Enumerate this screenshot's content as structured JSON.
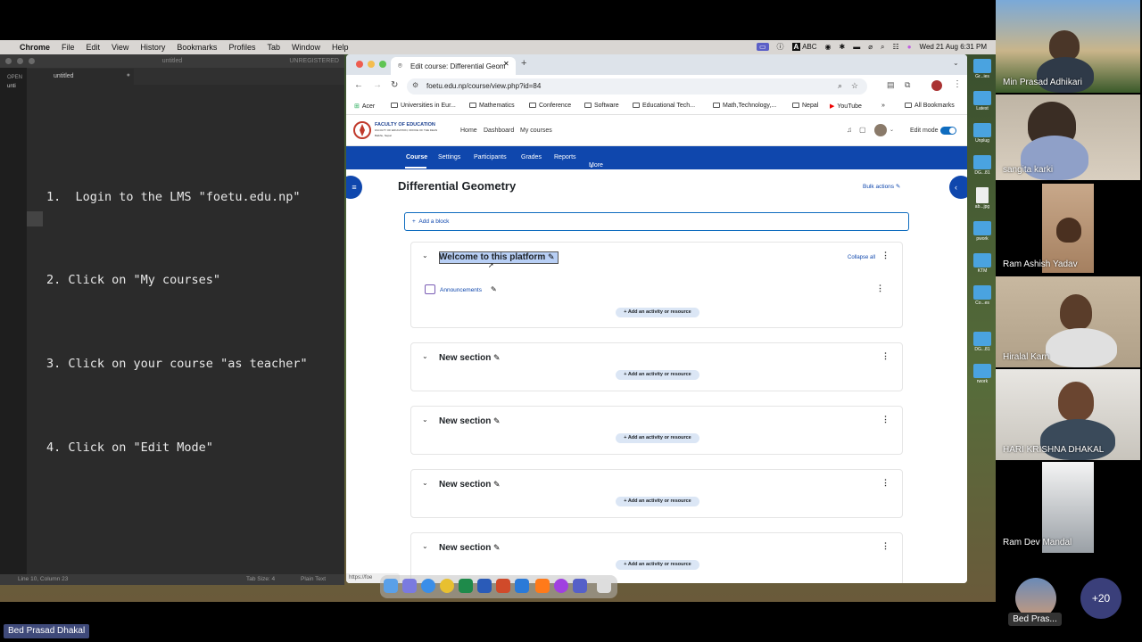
{
  "menubar": {
    "app": "Chrome",
    "items": [
      "File",
      "Edit",
      "View",
      "History",
      "Bookmarks",
      "Profiles",
      "Tab",
      "Window",
      "Help"
    ],
    "clock": "Wed 21 Aug  6:31 PM",
    "abc": "ABC"
  },
  "sublime": {
    "tab_title": "untitled",
    "window_title": "untitled",
    "unregistered": "UNREGISTERED",
    "sidebar_label": "OPEN",
    "sidebar_file": "unti",
    "lines": [
      "1.  Login to the LMS \"foetu.edu.np\"",
      "2. Click on \"My courses\"",
      "3. Click on your course \"as teacher\"",
      "4. Click on \"Edit Mode\""
    ],
    "status_left": "Line 10, Column 23",
    "status_tab": "Tab Size: 4",
    "status_syntax": "Plain Text"
  },
  "chrome": {
    "tab_title": "Edit course: Differential Geom",
    "url": "foetu.edu.np/course/view.php?id=84",
    "bookmarks": [
      "Acer",
      "Universities in Eur...",
      "Mathematics",
      "Conference",
      "Software",
      "Educational Tech...",
      "Math,Technology,...",
      "Nepal",
      "YouTube"
    ],
    "all_bookmarks": "All Bookmarks",
    "status_url": "https://foe"
  },
  "moodle": {
    "logo_title": "FACULTY OF EDUCATION",
    "logo_sub": "FACULTY OF EDUCATION, OFFICE OF THE DEAN",
    "logo_sub2": "Balkhu, Nepal",
    "top_links": [
      "Home",
      "Dashboard",
      "My courses"
    ],
    "edit_mode": "Edit mode",
    "nav": [
      "Course",
      "Settings",
      "Participants",
      "Grades",
      "Reports",
      "More"
    ],
    "course_title": "Differential Geometry",
    "bulk_actions": "Bulk actions",
    "add_block": "Add a block",
    "collapse_all": "Collapse all",
    "first_section": "Welcome to this platform",
    "announcements": "Announcements",
    "add_activity": "Add an activity or resource",
    "new_section": "New section"
  },
  "desktop_icons": [
    "Gr...ies",
    "Latest",
    "Unplug",
    "DG...81",
    "ab...jpg",
    "pwork",
    "KTM",
    "Co...es",
    "DG...81",
    "rwork"
  ],
  "participants": [
    "Min  Prasad Adhikari",
    "sangita karki",
    "Ram Ashish Yadav",
    "Hiralal Karn",
    "HARI KRISHNA DHAKAL",
    "Ram Dev Mandal"
  ],
  "self_name": "Bed Pras...",
  "more_count": "+20",
  "presenter": "Bed Prasad Dhakal"
}
